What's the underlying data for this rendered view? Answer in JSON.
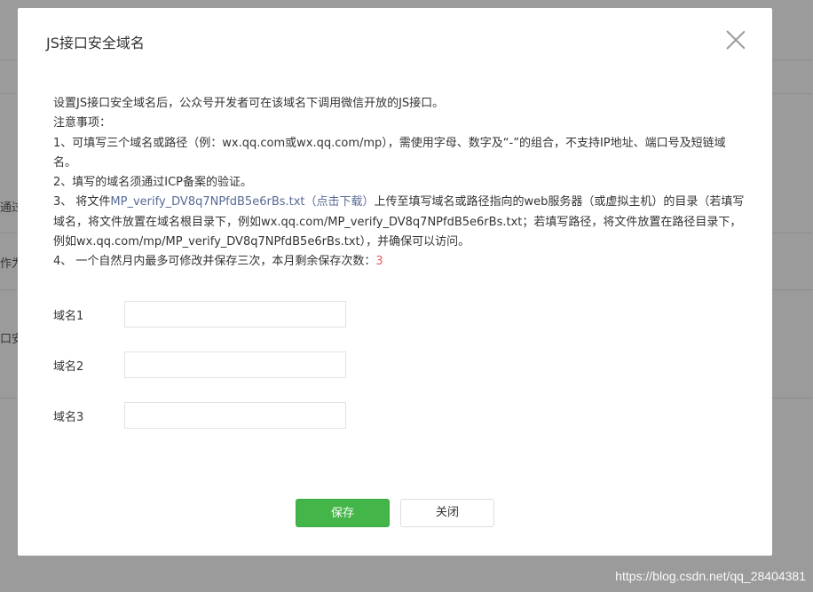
{
  "background": {
    "fragments": [
      "通过",
      "作为",
      "口安"
    ]
  },
  "modal": {
    "title": "JS接口安全域名",
    "intro": "设置JS接口安全域名后，公众号开发者可在该域名下调用微信开放的JS接口。",
    "notes_title": "注意事项：",
    "note1": "1、可填写三个域名或路径（例：wx.qq.com或wx.qq.com/mp），需使用字母、数字及“-”的组合，不支持IP地址、端口号及短链域名。",
    "note2": "2、填写的域名须通过ICP备案的验证。",
    "note3_prefix": "3、 将文件",
    "note3_file": "MP_verify_DV8q7NPfdB5e6rBs.txt（点击下载）",
    "note3_suffix": "上传至填写域名或路径指向的web服务器（或虚拟主机）的目录（若填写域名，将文件放置在域名根目录下，例如wx.qq.com/MP_verify_DV8q7NPfdB5e6rBs.txt；若填写路径，将文件放置在路径目录下，例如wx.qq.com/mp/MP_verify_DV8q7NPfdB5e6rBs.txt），并确保可以访问。",
    "note4_prefix": "4、 一个自然月内最多可修改并保存三次，本月剩余保存次数：",
    "note4_count": "3",
    "fields": [
      {
        "label": "域名1",
        "value": "",
        "placeholder": ""
      },
      {
        "label": "域名2",
        "value": "",
        "placeholder": ""
      },
      {
        "label": "域名3",
        "value": "",
        "placeholder": ""
      }
    ],
    "save_label": "保存",
    "close_label": "关闭"
  },
  "watermark": "https://blog.csdn.net/qq_28404381",
  "colors": {
    "accent_green": "#44b549",
    "link": "#576b95",
    "count_red": "#e15f63",
    "overlay": "#9a9a9a"
  }
}
